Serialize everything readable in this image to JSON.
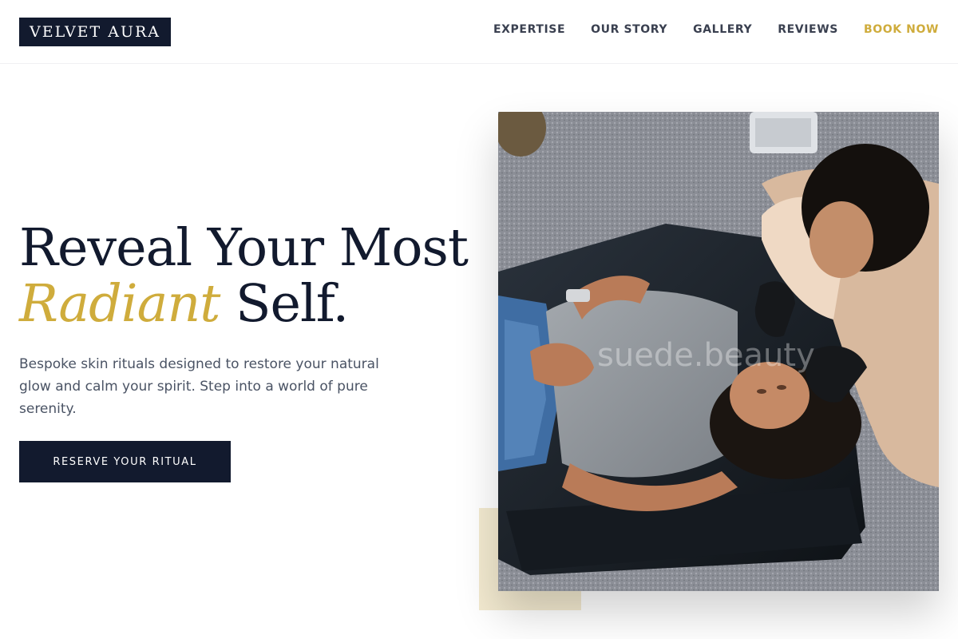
{
  "brand": {
    "name": "VELVET AURA"
  },
  "nav": {
    "items": [
      {
        "label": "EXPERTISE"
      },
      {
        "label": "OUR STORY"
      },
      {
        "label": "GALLERY"
      },
      {
        "label": "REVIEWS"
      },
      {
        "label": "BOOK NOW"
      }
    ]
  },
  "hero": {
    "headline_line1": "Reveal Your Most",
    "headline_accent": "Radiant",
    "headline_tail": "Self.",
    "description": "Bespoke skin rituals designed to restore your natural glow and calm your spirit. Step into a world of pure serenity.",
    "cta_label": "RESERVE YOUR RITUAL",
    "image_watermark": "suede.beauty"
  },
  "colors": {
    "navy": "#121a2e",
    "gold": "#cfac3c",
    "cream": "#f3ead0",
    "body_text": "#4a5364"
  }
}
